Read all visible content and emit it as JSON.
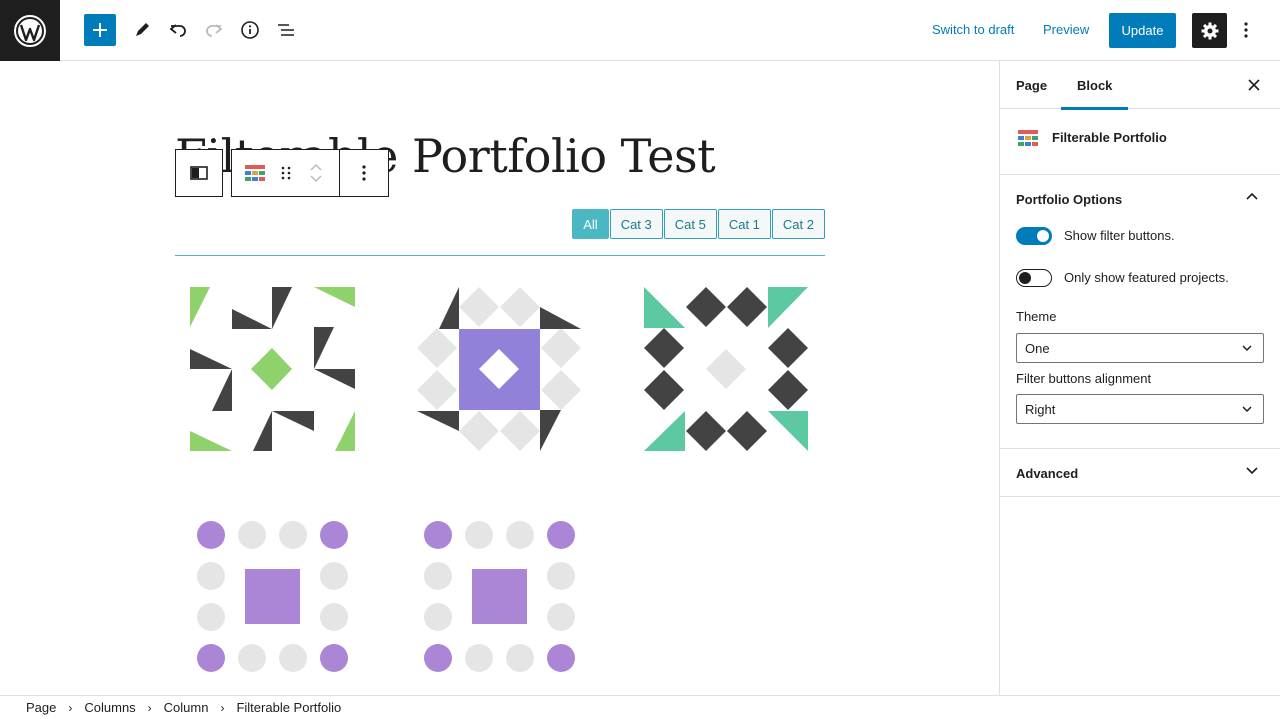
{
  "header": {
    "switch_to_draft": "Switch to draft",
    "preview": "Preview",
    "update": "Update"
  },
  "editor": {
    "title": "Filterable Portfolio Test",
    "filters": [
      "All",
      "Cat 3",
      "Cat 5",
      "Cat 1",
      "Cat 2"
    ],
    "active_filter": "All"
  },
  "sidebar": {
    "tabs": [
      "Page",
      "Block"
    ],
    "active_tab": "Block",
    "block_name": "Filterable Portfolio",
    "panel_title": "Portfolio Options",
    "toggles": [
      {
        "label": "Show filter buttons.",
        "on": true
      },
      {
        "label": "Only show featured projects.",
        "on": false
      }
    ],
    "theme_label": "Theme",
    "theme_value": "One",
    "alignment_label": "Filter buttons alignment",
    "alignment_value": "Right",
    "advanced_label": "Advanced"
  },
  "breadcrumb": [
    "Page",
    "Columns",
    "Column",
    "Filterable Portfolio"
  ],
  "colors": {
    "accent": "#007cba",
    "filter_teal": "#4ab7c2",
    "green": "#8fd16a",
    "dark": "#434343",
    "purple_square": "#9381d9",
    "teal": "#5cc9a0",
    "light_gray": "#e5e5e5",
    "lilac": "#ab86d6"
  }
}
